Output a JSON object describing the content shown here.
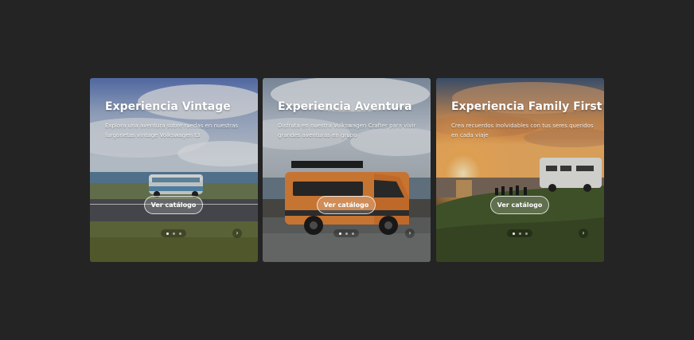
{
  "cards": [
    {
      "title": "Experiencia Vintage",
      "description": "Explora una aventura sobre ruedas en nuestras furgonetas vintage Volkswagen t3",
      "cta_label": "Ver catálogo",
      "image": "vintage-vw-t3-van-on-coastal-road",
      "slides": 3,
      "active_slide": 1,
      "next_icon": "chevron-right-icon"
    },
    {
      "title": "Experiencia Aventura",
      "description": "Disfruta en nuestra Volkswagen Crafter para vivir grandes aventuras en grupo",
      "cta_label": "Ver catálogo",
      "image": "orange-vw-crafter-van-on-wet-seafront",
      "slides": 3,
      "active_slide": 1,
      "next_icon": "chevron-right-icon"
    },
    {
      "title": "Experiencia Family First",
      "description": "Crea recuerdos inolvidables con tus seres queridos en cada viaje",
      "cta_label": "Ver catálogo",
      "image": "motorhome-on-clifftop-at-sunset",
      "slides": 3,
      "active_slide": 1,
      "next_icon": "chevron-right-icon"
    }
  ],
  "colors": {
    "page_background": "#242424",
    "title_text": "#ffffff",
    "cta_border": "#ffffff"
  }
}
